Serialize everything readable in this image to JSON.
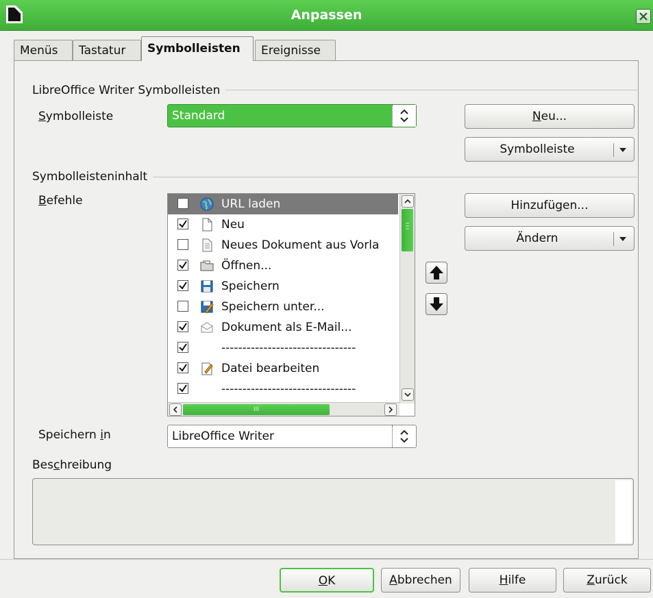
{
  "window": {
    "title": "Anpassen"
  },
  "tabs": [
    {
      "label": "Menüs"
    },
    {
      "label": "Tastatur"
    },
    {
      "label": "Symbolleisten"
    },
    {
      "label": "Ereignisse"
    }
  ],
  "toolbars_group": {
    "heading": "LibreOffice Writer Symbolleisten",
    "field_label_prefix": "S",
    "field_label_rest": "ymbolleiste",
    "combo_value": "Standard",
    "new_button_u": "N",
    "new_button_rest": "eu...",
    "toolbar_menu_button": "Symbolleiste"
  },
  "content_group": {
    "heading": "Symbolleisteninhalt",
    "commands_label_prefix": "B",
    "commands_label_rest": "efehle",
    "commands": [
      {
        "label": "URL laden",
        "checked": false,
        "icon": "globe-icon"
      },
      {
        "label": "Neu",
        "checked": true,
        "icon": "page-icon"
      },
      {
        "label": "Neues Dokument aus Vorla",
        "checked": false,
        "icon": "template-icon"
      },
      {
        "label": "Öffnen...",
        "checked": true,
        "icon": "folder-icon"
      },
      {
        "label": "Speichern",
        "checked": true,
        "icon": "floppy-icon"
      },
      {
        "label": "Speichern unter...",
        "checked": false,
        "icon": "floppy-edit-icon"
      },
      {
        "label": "Dokument als E-Mail...",
        "checked": true,
        "icon": "envelope-icon"
      },
      {
        "label": "--------------------------------",
        "checked": true,
        "icon": ""
      },
      {
        "label": "Datei bearbeiten",
        "checked": true,
        "icon": "edit-file-icon"
      },
      {
        "label": "--------------------------------",
        "checked": true,
        "icon": ""
      }
    ],
    "hscroll_mark": "III",
    "add_button_pre": "Hinzufü",
    "add_button_u": "g",
    "add_button_post": "en...",
    "modify_button": "Ändern"
  },
  "save_in": {
    "label_pre": "Speichern ",
    "label_u": "i",
    "label_post": "n",
    "value": "LibreOffice Writer"
  },
  "description": {
    "label_pre": "Bes",
    "label_u": "c",
    "label_post": "hreibung"
  },
  "footer": {
    "ok_u": "O",
    "ok_rest": "K",
    "cancel_u": "A",
    "cancel_rest": "bbrechen",
    "help_u": "H",
    "help_rest": "ilfe",
    "back_u": "Z",
    "back_rest": "urück"
  },
  "colors": {
    "accent": "#4cc244",
    "selection": "#7a7a7a"
  }
}
